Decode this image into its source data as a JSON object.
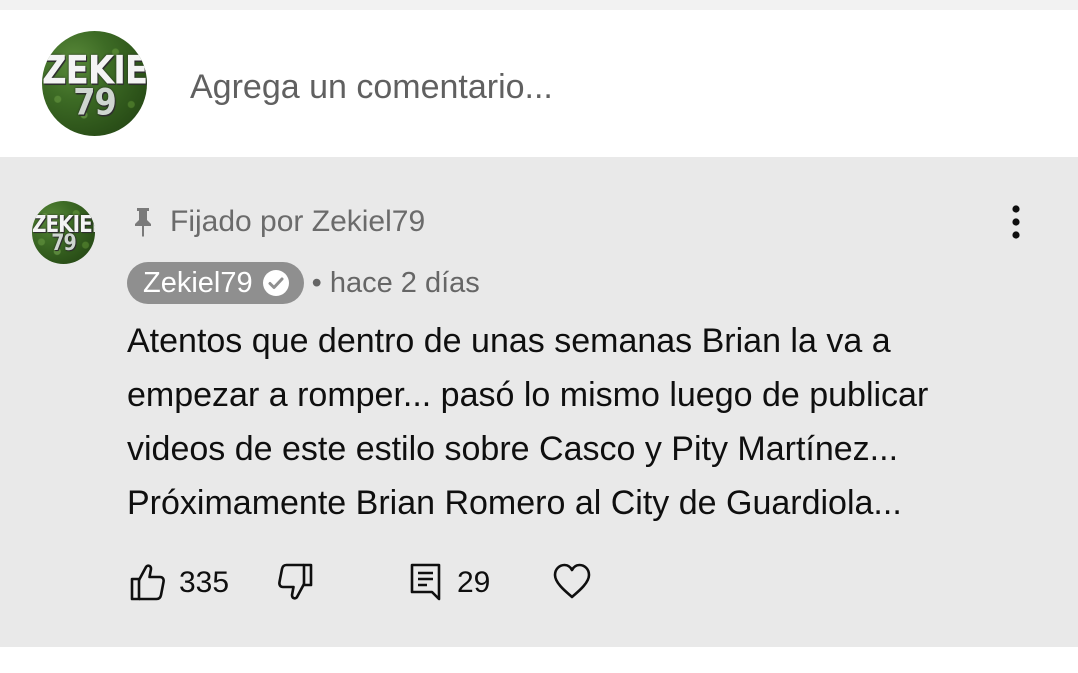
{
  "compose": {
    "avatar_text_line1": "ZEKIEL",
    "avatar_text_line2": "79",
    "placeholder": "Agrega un comentario..."
  },
  "comment": {
    "pinned_label": "Fijado por Zekiel79",
    "author": "Zekiel79",
    "author_verified": true,
    "timestamp": "• hace 2 días",
    "avatar_text_line1": "ZEKIEL",
    "avatar_text_line2": "79",
    "body_lines": [
      "Atentos que dentro de unas semanas Brian la va a",
      "empezar a romper... pasó lo mismo luego de publicar",
      "videos de este estilo sobre Casco y Pity Martínez...",
      "Próximamente Brian Romero al City de Guardiola..."
    ],
    "likes": "335",
    "replies": "29"
  },
  "icons": {
    "pin": "pin-icon",
    "more": "more-vert-icon",
    "verified": "verified-check-icon",
    "like": "thumbs-up-icon",
    "dislike": "thumbs-down-icon",
    "reply": "comment-reply-icon",
    "heart": "heart-icon"
  },
  "colors": {
    "card_background": "#e9e9e9",
    "author_chip": "#8f8f8f",
    "secondary_text": "#6b6b6b"
  }
}
